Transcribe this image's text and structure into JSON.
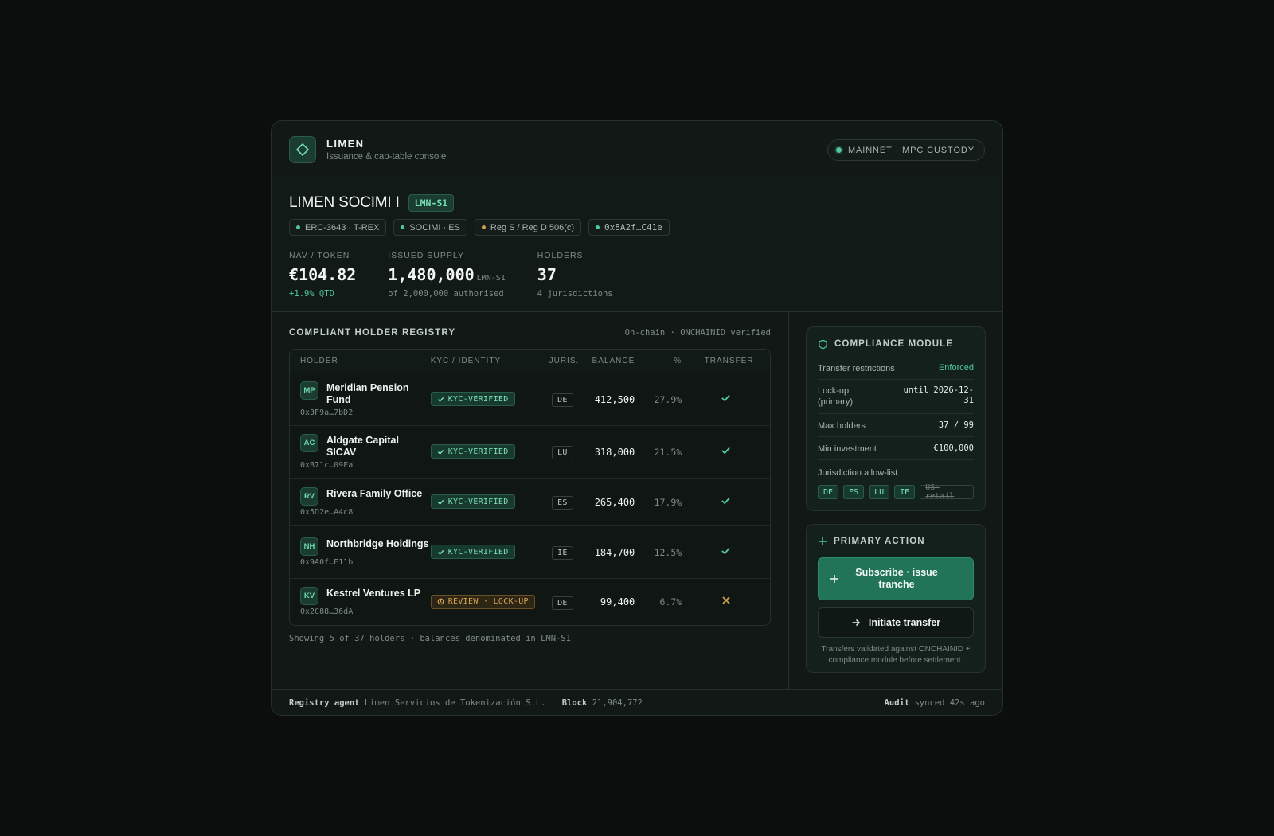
{
  "app": {
    "name": "LIMEN",
    "subtitle": "Issuance & cap-table console",
    "network": "MAINNET · MPC CUSTODY"
  },
  "asset": {
    "title": "LIMEN SOCIMI I",
    "ticker": "LMN-S1",
    "tags": [
      "ERC-3643 · T-REX",
      "SOCIMI · ES",
      "Reg S / Reg D 506(c)",
      "0x8A2f…C41e"
    ]
  },
  "metrics": {
    "nav": {
      "label": "NAV / TOKEN",
      "value": "€104.82",
      "sub": "+1.9% QTD"
    },
    "supply": {
      "label": "ISSUED SUPPLY",
      "value": "1,480,000",
      "unit": "LMN-S1",
      "sub": "of 2,000,000 authorised"
    },
    "holders": {
      "label": "HOLDERS",
      "value": "37",
      "sub": "4 jurisdictions"
    }
  },
  "registry": {
    "title": "COMPLIANT HOLDER REGISTRY",
    "note": "On-chain · ONCHAINID verified",
    "columns": [
      "HOLDER",
      "KYC / IDENTITY",
      "JURIS.",
      "BALANCE",
      "%",
      "TRANSFER"
    ],
    "rows": [
      {
        "initials": "MP",
        "name": "Meridian Pension Fund",
        "addr": "0x3F9a…7bD2",
        "kyc": "KYC-VERIFIED",
        "jur": "DE",
        "balance": "412,500",
        "pct": "27.9%"
      },
      {
        "initials": "AC",
        "name": "Aldgate Capital SICAV",
        "addr": "0xB71c…09Fa",
        "kyc": "KYC-VERIFIED",
        "jur": "LU",
        "balance": "318,000",
        "pct": "21.5%"
      },
      {
        "initials": "RV",
        "name": "Rivera Family Office",
        "addr": "0x5D2e…A4c8",
        "kyc": "KYC-VERIFIED",
        "jur": "ES",
        "balance": "265,400",
        "pct": "17.9%"
      },
      {
        "initials": "NH",
        "name": "Northbridge Holdings",
        "addr": "0x9A0f…E11b",
        "kyc": "KYC-VERIFIED",
        "jur": "IE",
        "balance": "184,700",
        "pct": "12.5%"
      },
      {
        "initials": "KV",
        "name": "Kestrel Ventures LP",
        "addr": "0x2C88…36dA",
        "kyc": "REVIEW · LOCK-UP",
        "jur": "DE",
        "balance": "99,400",
        "pct": "6.7%"
      }
    ],
    "footer": "Showing 5 of 37 holders · balances denominated in LMN-S1"
  },
  "compliance": {
    "title": "COMPLIANCE MODULE",
    "rules": [
      {
        "k": "Transfer restrictions",
        "v": "Enforced"
      },
      {
        "k": "Lock-up (primary)",
        "v": "until 2026-12-31"
      },
      {
        "k": "Max holders",
        "v": "37 / 99"
      },
      {
        "k": "Min investment",
        "v": "€100,000"
      }
    ],
    "allow_label": "Jurisdiction allow-list",
    "allow": [
      "DE",
      "ES",
      "LU",
      "IE"
    ],
    "blocked": "US-retail"
  },
  "action": {
    "title": "PRIMARY ACTION",
    "primary": "Subscribe · issue tranche",
    "secondary": "Initiate transfer",
    "note": "Transfers validated against ONCHAINID + compliance module before settlement."
  },
  "footer": {
    "agent_label": "Registry agent",
    "agent": "Limen Servicios de Tokenización S.L.",
    "block_label": "Block",
    "block": "21,904,772",
    "audit_label": "Audit",
    "audit": "synced 42s ago"
  },
  "colors": {
    "accent": "#4fc99a",
    "warning": "#d0a04c",
    "background": "#0b0e0d",
    "surface": "#111816"
  }
}
